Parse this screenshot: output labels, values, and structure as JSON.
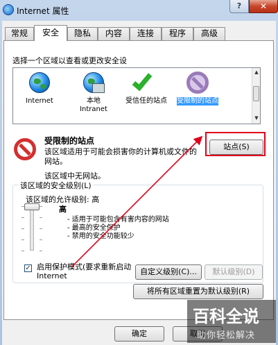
{
  "window": {
    "title": "Internet 属性",
    "help": "?",
    "close": "✕"
  },
  "tabs": [
    {
      "label": "常规",
      "active": false
    },
    {
      "label": "安全",
      "active": true
    },
    {
      "label": "隐私",
      "active": false
    },
    {
      "label": "内容",
      "active": false
    },
    {
      "label": "连接",
      "active": false
    },
    {
      "label": "程序",
      "active": false
    },
    {
      "label": "高级",
      "active": false
    }
  ],
  "security": {
    "zone_prompt": "选择一个区域以查看或更改安全设",
    "zones": [
      {
        "label": "Internet",
        "icon": "globe-icon"
      },
      {
        "label": "本地 Intranet",
        "icon": "local-intranet-icon"
      },
      {
        "label": "受信任的站点",
        "icon": "checkmark-icon"
      },
      {
        "label": "受限制的站点",
        "icon": "restricted-icon",
        "selected": true
      }
    ],
    "selected_zone": {
      "title": "受限制的站点",
      "description": "该区域适用于可能会损害你的计算机或文件的网站。",
      "no_sites": "该区域中无网站。",
      "sites_button": "站点(S)"
    },
    "level_group": {
      "label": "该区域的安全级别(L)",
      "allowed": "该区域的允许级别: 高",
      "level": "高",
      "bullets": [
        "- 适用于可能包含有害内容的网站",
        "- 最高的安全保护",
        "- 禁用的安全功能较少"
      ],
      "slider_level": "高"
    },
    "protected_mode": {
      "label": "启用保护模式(要求重新启动 Internet",
      "checked": true
    },
    "custom_level_button": "自定义级别(C)...",
    "default_level_button": "默认级别(D)",
    "reset_all_button": "将所有区域重置为默认级别(R)"
  },
  "footer": {
    "ok": "确定",
    "cancel": "取消"
  },
  "watermark": {
    "top": "百科全说",
    "bottom": "助你轻松解决"
  },
  "colors": {
    "selection": "#3399ff",
    "annotation": "#e1001a"
  }
}
